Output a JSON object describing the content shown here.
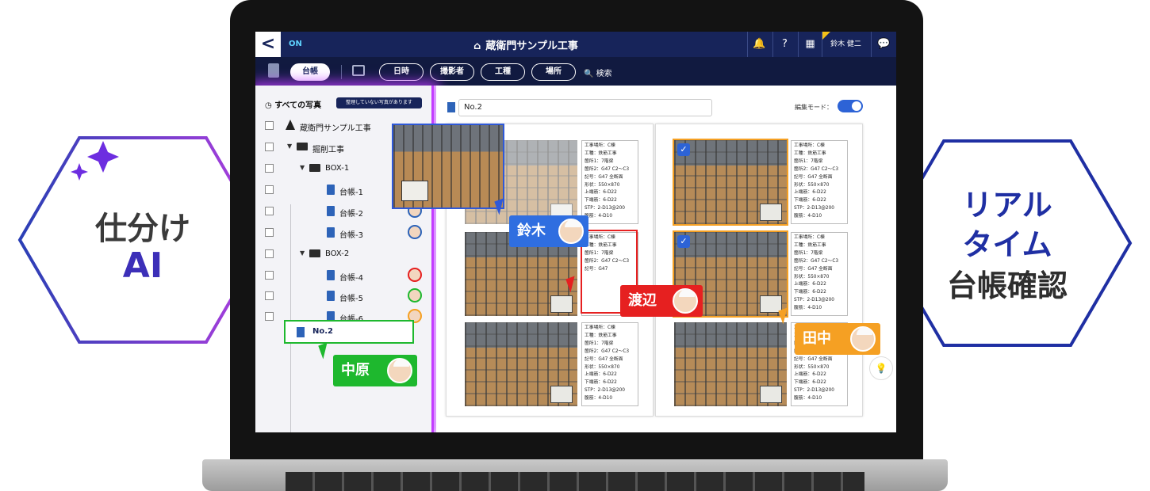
{
  "badges": {
    "left": {
      "line1": "仕分け",
      "line2": "AI"
    },
    "right": {
      "line1": "リアル",
      "line2": "タイム",
      "line3": "台帳確認"
    }
  },
  "topbar": {
    "back_label": "<",
    "status": "ON",
    "title": "蔵衛門サンプル工事",
    "user": "鈴木 健二",
    "icons": [
      "home-icon",
      "bell-icon",
      "help-icon",
      "grid-icon",
      "chat-icon"
    ]
  },
  "filterbar": {
    "ledger_tab": "台帳",
    "pills": [
      "日時",
      "撮影者",
      "工種",
      "場所"
    ],
    "search": "検索"
  },
  "tree": {
    "all_photos": "すべての写真",
    "unorganized_badge": "整理していない写真があります",
    "items": [
      {
        "label": "蔵衛門サンプル工事",
        "level": 0,
        "icon": "cone-icon"
      },
      {
        "label": "掘削工事",
        "level": 1,
        "icon": "folder-icon"
      },
      {
        "label": "BOX-1",
        "level": 2,
        "icon": "folder-icon"
      },
      {
        "label": "台帳-1",
        "level": 3,
        "icon": "ledger-icon"
      },
      {
        "label": "台帳-2",
        "level": 3,
        "icon": "ledger-icon"
      },
      {
        "label": "台帳-3",
        "level": 3,
        "icon": "ledger-icon"
      },
      {
        "label": "BOX-2",
        "level": 2,
        "icon": "folder-icon"
      },
      {
        "label": "台帳-4",
        "level": 3,
        "icon": "ledger-icon"
      },
      {
        "label": "台帳-5",
        "level": 3,
        "icon": "ledger-icon"
      },
      {
        "label": "台帳-6",
        "level": 3,
        "icon": "ledger-icon"
      }
    ],
    "new_ledger": "No.2"
  },
  "main": {
    "ledger_name": "No.2",
    "edit_mode_label": "編集モード：",
    "edit_mode_on": true,
    "spec_full": [
      "工事場所：C棟",
      "工種：鉄筋工事",
      "箇所1：7階梁",
      "箇所2：G47 C2～C3",
      "記号：G47 全断面",
      "形状：550×870",
      "上端筋：6-D22",
      "下端筋：6-D22",
      "STP：2-D13@200",
      "腹筋：4-D10"
    ],
    "spec_short": [
      "工事場所：C棟",
      "工種：鉄筋工事",
      "箇所1：7階梁",
      "箇所2：G47 C2～C3",
      "記号：G47",
      "",
      "",
      "",
      "",
      "4-D10"
    ],
    "spec_partial": [
      "",
      "",
      "",
      "",
      "",
      "",
      "",
      "",
      "STP：2-D13@200",
      "4-D10"
    ]
  },
  "users": {
    "suzuki": "鈴木",
    "watanabe": "渡辺",
    "tanaka": "田中",
    "nakahara": "中原"
  },
  "colors": {
    "navy": "#17245a",
    "blue": "#2f6ee0",
    "red": "#e62020",
    "orange": "#f5a023",
    "green": "#1eb82e",
    "purple_glow": "#c33dff"
  }
}
